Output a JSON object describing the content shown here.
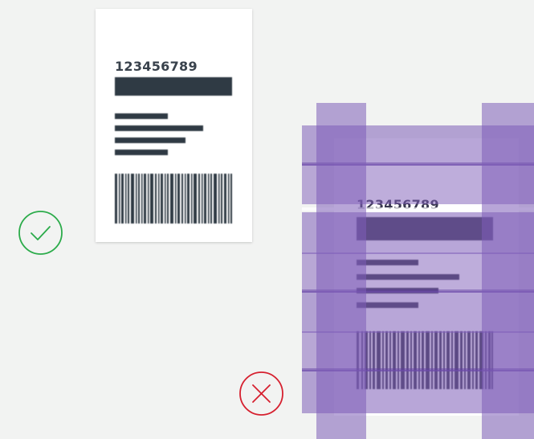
{
  "good_example": {
    "label_number": "123456789",
    "status_icon": "check-circle-icon",
    "status_color": "#2bab4a"
  },
  "bad_example": {
    "label_number": "123456789",
    "status_icon": "x-circle-icon",
    "status_color": "#d6202f",
    "tape_color": "#7d5cb8"
  }
}
